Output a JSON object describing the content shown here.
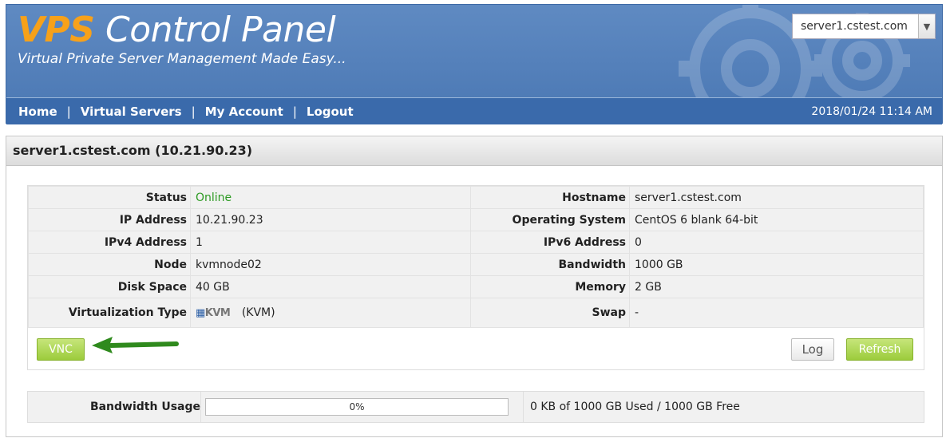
{
  "header": {
    "logo_vps": "VPS",
    "logo_rest": "Control Panel",
    "tagline": "Virtual Private Server Management Made Easy...",
    "server_select": "server1.cstest.com",
    "datetime": "2018/01/24 11:14 AM"
  },
  "nav": {
    "items": [
      {
        "label": "Home"
      },
      {
        "label": "Virtual Servers"
      },
      {
        "label": "My Account"
      },
      {
        "label": "Logout"
      }
    ],
    "separator": "|"
  },
  "panel": {
    "title": "server1.cstest.com (10.21.90.23)"
  },
  "info": {
    "left": [
      {
        "label": "Status",
        "value": "Online"
      },
      {
        "label": "IP Address",
        "value": "10.21.90.23"
      },
      {
        "label": "IPv4 Address",
        "value": "1"
      },
      {
        "label": "Node",
        "value": "kvmnode02"
      },
      {
        "label": "Disk Space",
        "value": "40 GB"
      },
      {
        "label": "Virtualization Type",
        "value": "(KVM)",
        "logo": "KVM"
      }
    ],
    "right": [
      {
        "label": "Hostname",
        "value": "server1.cstest.com"
      },
      {
        "label": "Operating System",
        "value": "CentOS 6 blank 64-bit"
      },
      {
        "label": "IPv6 Address",
        "value": "0"
      },
      {
        "label": "Bandwidth",
        "value": "1000 GB"
      },
      {
        "label": "Memory",
        "value": "2 GB"
      },
      {
        "label": "Swap",
        "value": "-"
      }
    ],
    "status_color": "#2c9a22"
  },
  "buttons": {
    "vnc": "VNC",
    "log": "Log",
    "refresh": "Refresh"
  },
  "bandwidth": {
    "label": "Bandwidth Usage",
    "percent_text": "0%",
    "percent": 0,
    "summary": "0 KB of 1000 GB Used / 1000 GB Free"
  },
  "icons": {
    "select_arrow": "chevron-down-icon",
    "annotation": "green-arrow-icon"
  }
}
